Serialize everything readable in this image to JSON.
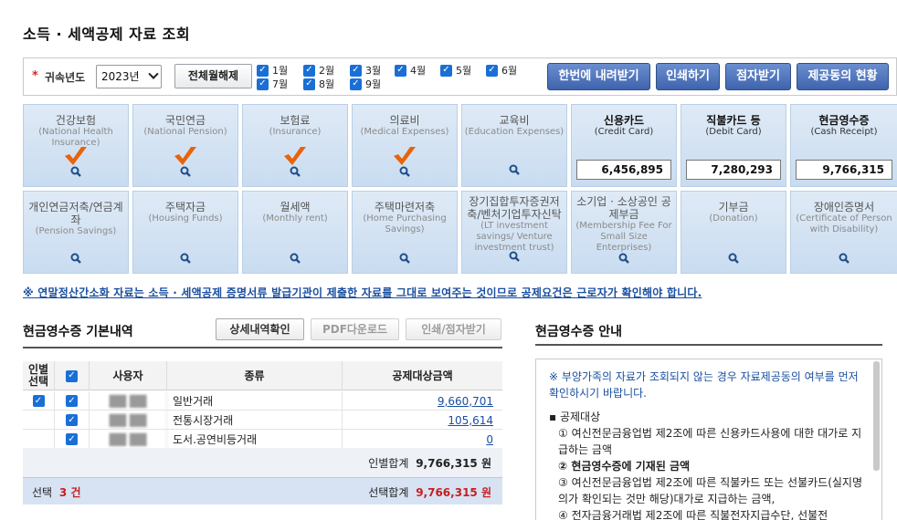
{
  "page_title": "소득 · 세액공제 자료 조회",
  "filter": {
    "required_mark": "*",
    "year_label": "귀속년도",
    "year_value": "2023년",
    "clear_button": "전체월해제",
    "months": [
      "1월",
      "2월",
      "3월",
      "4월",
      "5월",
      "6월",
      "7월",
      "8월",
      "9월"
    ],
    "actions": [
      "한번에 내려받기",
      "인쇄하기",
      "점자받기",
      "제공동의 현황"
    ]
  },
  "categories": [
    {
      "kr": "건강보험",
      "en": "(National Health Insurance)",
      "checked": true
    },
    {
      "kr": "국민연금",
      "en": "(National Pension)",
      "checked": true
    },
    {
      "kr": "보험료",
      "en": "(Insurance)",
      "checked": true
    },
    {
      "kr": "의료비",
      "en": "(Medical Expenses)",
      "checked": true
    },
    {
      "kr": "교육비",
      "en": "(Education Expenses)",
      "checked": false
    },
    {
      "kr": "신용카드",
      "en": "(Credit Card)",
      "amount": "6,456,895"
    },
    {
      "kr": "직불카드 등",
      "en": "(Debit Card)",
      "amount": "7,280,293"
    },
    {
      "kr": "현금영수증",
      "en": "(Cash Receipt)",
      "amount": "9,766,315"
    },
    {
      "kr": "개인연금저축/연금계좌",
      "en": "(Pension Savings)"
    },
    {
      "kr": "주택자금",
      "en": "(Housing Funds)"
    },
    {
      "kr": "월세액",
      "en": "(Monthly rent)"
    },
    {
      "kr": "주택마련저축",
      "en": "(Home Purchasing Savings)"
    },
    {
      "kr": "장기집합투자증권저축/벤처기업투자신탁",
      "en": "(LT investment savings/ Venture investment trust)"
    },
    {
      "kr": "소기업 · 소상공인 공제부금",
      "en": "(Membership Fee For Small Size Enterprises)"
    },
    {
      "kr": "기부금",
      "en": "(Donation)"
    },
    {
      "kr": "장애인증명서",
      "en": "(Certificate of Person with Disability)"
    }
  ],
  "notice": "※ 연말정산간소화 자료는 소득 · 세액공제 증명서류 발급기관이 제출한 자료를 그대로 보여주는 것이므로 공제요건은 근로자가 확인해야 합니다.",
  "left": {
    "title": "현금영수증 기본내역",
    "btn_detail": "상세내역확인",
    "btn_pdf": "PDF다운로드",
    "btn_print": "인쇄/점자받기",
    "headers": {
      "select": "인별 선택",
      "user": "사용자",
      "type": "종류",
      "amount": "공제대상금액"
    },
    "rows": [
      {
        "user": "██ ██",
        "type": "일반거래",
        "amount": "9,660,701"
      },
      {
        "user": "██ ██",
        "type": "전통시장거래",
        "amount": "105,614"
      },
      {
        "user": "██ ██",
        "type": "도서.공연비등거래",
        "amount": "0"
      }
    ],
    "person_total_label": "인별합계",
    "person_total_value": "9,766,315 원",
    "select_label": "선택",
    "select_count": "3 건",
    "select_total_label": "선택합계",
    "select_total_value": "9,766,315 원"
  },
  "right": {
    "title": "현금영수증 안내",
    "note": "※ 부양가족의 자료가 조회되지 않는 경우 자료제공동의 여부를 먼저 확인하시기 바랍니다.",
    "list_title": "▪ 공제대상",
    "item1": "① 여신전문금융업법 제2조에 따른 신용카드사용에 대한 대가로 지급하는 금액",
    "item2": "② 현금영수증에 기재된 금액",
    "item3": "③ 여신전문금융업법 제2조에 따른 직불카드 또는 선불카드(실지명의가 확인되는 것만 해당)대가로 지급하는 금액,",
    "item4": "④ 전자금융거래법 제2조에 따른 직불전자지급수단, 선불전"
  },
  "colors": {
    "accent": "#1a6fd6",
    "button_blue": "#4a6fb8",
    "check_orange": "#e8630a",
    "tile_bg": "#d3e2f3"
  }
}
